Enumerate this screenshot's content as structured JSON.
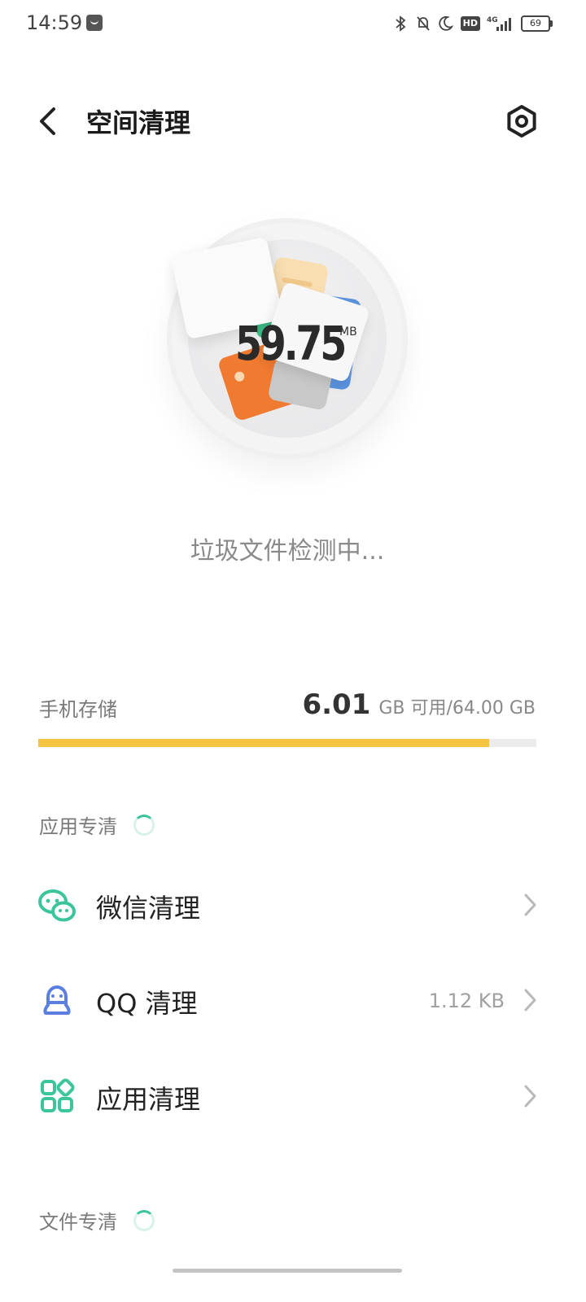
{
  "status_bar": {
    "time": "14:59",
    "network": "4G",
    "hd": "HD",
    "battery": "69"
  },
  "header": {
    "title": "空间清理"
  },
  "hero": {
    "size_value": "59.75",
    "size_unit": "MB",
    "status_text": "垃圾文件检测中..."
  },
  "storage": {
    "label": "手机存储",
    "free_value": "6.01",
    "detail": "GB 可用/64.00 GB",
    "used_fraction": 0.906
  },
  "sections": {
    "app_clean_title": "应用专清",
    "file_clean_title": "文件专清"
  },
  "rows": {
    "wechat": {
      "label": "微信清理",
      "value": ""
    },
    "qq": {
      "label": "QQ 清理",
      "value": "1.12 KB"
    },
    "apps": {
      "label": "应用清理",
      "value": ""
    }
  },
  "colors": {
    "accent_green": "#3cc49b",
    "storage_bar": "#f5c342",
    "qq_blue": "#5b7fe0"
  }
}
